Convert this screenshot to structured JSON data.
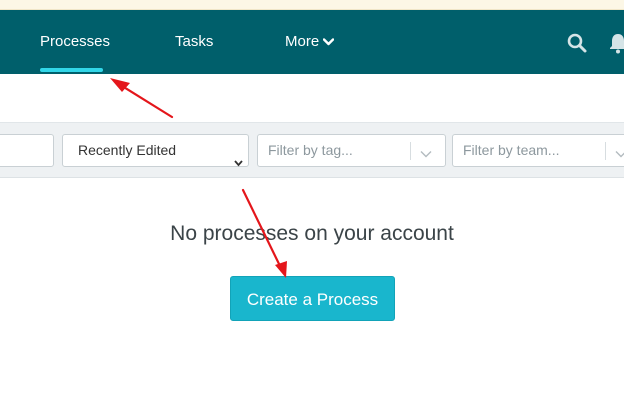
{
  "nav": {
    "items": [
      {
        "label": "Processes",
        "active": true
      },
      {
        "label": "Tasks",
        "active": false
      },
      {
        "label": "More",
        "active": false
      }
    ],
    "icons": [
      "search-icon",
      "bell-icon",
      "chevron-down-icon"
    ]
  },
  "filters": {
    "search": {
      "value": ""
    },
    "sort": {
      "selected": "Recently Edited"
    },
    "tag": {
      "placeholder": "Filter by tag..."
    },
    "team": {
      "placeholder": "Filter by team..."
    }
  },
  "empty_state": {
    "message": "No processes on your account",
    "button_label": "Create a Process"
  },
  "colors": {
    "navbar": "#005f6b",
    "active_underline": "#32d6e8",
    "button": "#19b6cd",
    "annotation_arrow": "#e4161b"
  }
}
